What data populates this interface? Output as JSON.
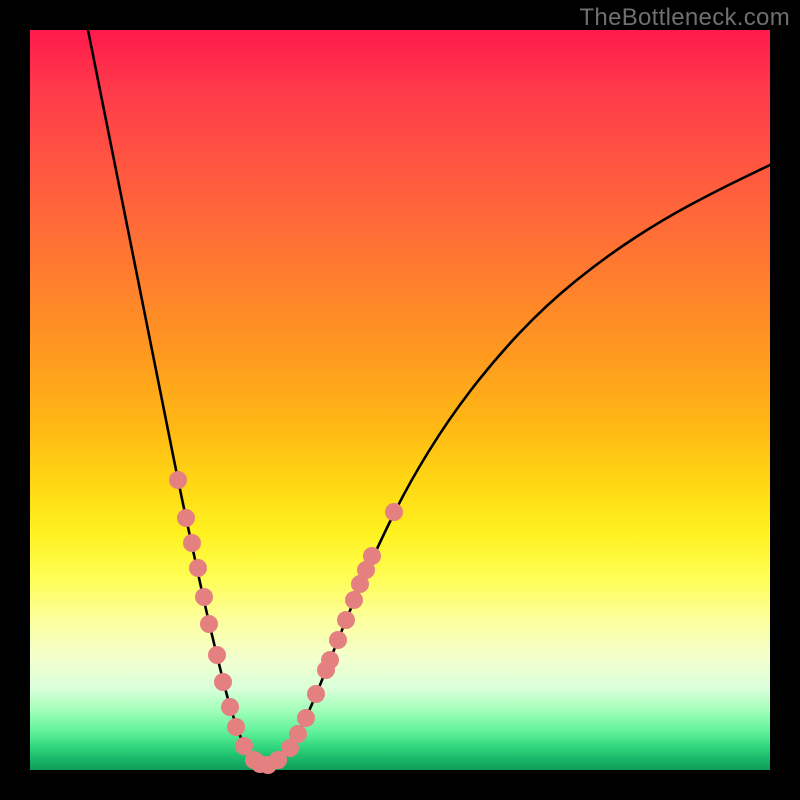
{
  "watermark": "TheBottleneck.com",
  "chart_data": {
    "type": "line",
    "title": "",
    "xlabel": "",
    "ylabel": "",
    "xlim": [
      30,
      770
    ],
    "ylim": [
      770,
      30
    ],
    "series": [
      {
        "name": "bottleneck-curve",
        "points": [
          [
            88,
            30
          ],
          [
            100,
            90
          ],
          [
            114,
            160
          ],
          [
            130,
            240
          ],
          [
            148,
            330
          ],
          [
            164,
            410
          ],
          [
            180,
            490
          ],
          [
            194,
            555
          ],
          [
            206,
            610
          ],
          [
            218,
            660
          ],
          [
            228,
            700
          ],
          [
            236,
            725
          ],
          [
            244,
            746
          ],
          [
            252,
            758
          ],
          [
            260,
            764
          ],
          [
            266,
            766
          ],
          [
            274,
            764
          ],
          [
            282,
            758
          ],
          [
            292,
            745
          ],
          [
            302,
            726
          ],
          [
            314,
            700
          ],
          [
            330,
            660
          ],
          [
            350,
            610
          ],
          [
            376,
            550
          ],
          [
            408,
            485
          ],
          [
            448,
            420
          ],
          [
            494,
            360
          ],
          [
            546,
            305
          ],
          [
            604,
            258
          ],
          [
            662,
            220
          ],
          [
            718,
            190
          ],
          [
            770,
            165
          ]
        ]
      }
    ],
    "markers": {
      "name": "sampled-points",
      "color": "#e58080",
      "radius": 9,
      "points": [
        [
          178,
          480
        ],
        [
          186,
          518
        ],
        [
          192,
          543
        ],
        [
          198,
          568
        ],
        [
          204,
          597
        ],
        [
          209,
          624
        ],
        [
          217,
          655
        ],
        [
          223,
          682
        ],
        [
          230,
          707
        ],
        [
          236,
          727
        ],
        [
          244,
          746
        ],
        [
          254,
          760
        ],
        [
          260,
          764
        ],
        [
          268,
          765
        ],
        [
          278,
          760
        ],
        [
          290,
          748
        ],
        [
          298,
          734
        ],
        [
          306,
          718
        ],
        [
          316,
          694
        ],
        [
          326,
          670
        ],
        [
          330,
          660
        ],
        [
          338,
          640
        ],
        [
          346,
          620
        ],
        [
          354,
          600
        ],
        [
          360,
          584
        ],
        [
          366,
          570
        ],
        [
          372,
          556
        ],
        [
          394,
          512
        ]
      ]
    }
  }
}
